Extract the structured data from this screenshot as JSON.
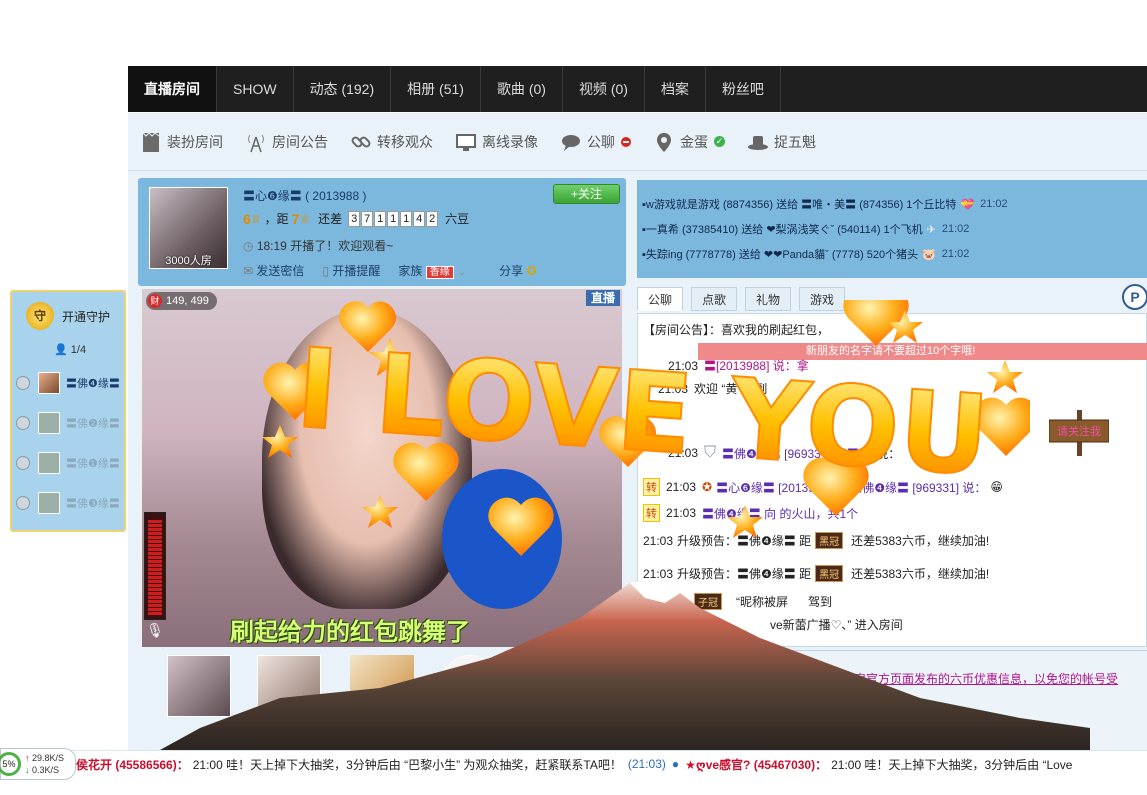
{
  "nav": {
    "tabs": [
      {
        "label": "直播房间"
      },
      {
        "label": "SHOW"
      },
      {
        "label": "动态 (192)"
      },
      {
        "label": "相册 (51)"
      },
      {
        "label": "歌曲 (0)"
      },
      {
        "label": "视频 (0)"
      },
      {
        "label": "档案"
      },
      {
        "label": "粉丝吧"
      }
    ]
  },
  "toolbar": {
    "items": [
      {
        "label": "装扮房间",
        "icon": "doc-icon"
      },
      {
        "label": "房间公告",
        "icon": "broadcast-tower-icon"
      },
      {
        "label": "转移观众",
        "icon": "link-icon"
      },
      {
        "label": "离线录像",
        "icon": "monitor-icon"
      },
      {
        "label": "公聊",
        "icon": "chat-bubble-icon"
      },
      {
        "label": "金蛋",
        "icon": "map-pin-icon"
      },
      {
        "label": "捉五魁",
        "icon": "hat-icon"
      }
    ]
  },
  "anchor": {
    "name": "〓心❻缘〓 ( 2013988 )",
    "viewers": "3000人房",
    "follow_label": "+关注",
    "level_from": "6",
    "level_to": "7",
    "dist_label": "，距",
    "diff_label": "还差",
    "diff_digits": [
      "3",
      "7",
      "1",
      "1",
      "1",
      "4",
      "2"
    ],
    "diff_unit": "六豆",
    "start_text": "18:19 开播了！欢迎观看~",
    "actions": {
      "message": "发送密信",
      "remind": "开播提醒",
      "family": "家族",
      "family_badge": "香缘",
      "share": "分享"
    }
  },
  "video": {
    "cash": "149, 499",
    "cash_icon": "财",
    "live_label": "直播",
    "subtitle": "刷起给力的红包跳舞了"
  },
  "guard": {
    "title": "开通守护",
    "shield_text": "守",
    "count": "1/4",
    "rows": [
      {
        "name": "〓佛❹缘〓",
        "active": true
      },
      {
        "name": "〓佛❷缘〓",
        "active": false
      },
      {
        "name": "〓佛❶缘〓",
        "active": false
      },
      {
        "name": "〓佛❸缘〓",
        "active": false
      }
    ]
  },
  "gifts": [
    {
      "text": "▪w游戏就是游戏 (8874356) 送给 〓唯・美〓 (874356) 1个丘比特",
      "time": "21:02"
    },
    {
      "text": "▪一真希 (37385410) 送给 ❤梨涡浅笑ぐˇ (540114) 1个飞机",
      "time": "21:02"
    },
    {
      "text": "▪失踪ing (7778778) 送给 ❤❤Panda貓ˇ (7778) 520个猪头",
      "time": "21:02"
    }
  ],
  "chat": {
    "tabs": [
      {
        "label": "公聊"
      },
      {
        "label": "点歌"
      },
      {
        "label": "礼物"
      },
      {
        "label": "游戏"
      }
    ],
    "p_badge": "P",
    "notice_bar": "新朋友的名字请不要超过10个字哦!",
    "announcement": "【房间公告】：喜欢我的刷起红包，",
    "lines": [
      {
        "time": "21:03",
        "text": "〓[2013988] 说：拿"
      },
      {
        "time": "21:03",
        "text": "欢迎 “黄",
        "extra": "驾到"
      },
      {
        "time": "21:03",
        "text": "〓佛❹缘〓 [96933 ❻缘〓 [2",
        "extra": "说："
      },
      {
        "time": "21:03",
        "text": "〓心❻缘〓 [2013988] 对 〓佛❹缘〓 [969331] 说：",
        "zhuan": "转"
      },
      {
        "time": "21:03",
        "text": "〓佛❹缘〓 向 的火山，共1个",
        "zhuan": "转"
      },
      {
        "time": "21:03",
        "text": "升级预告：〓佛❹缘〓 距",
        "rank": "黑冠",
        "extra": "还差5383六币，继续加油!"
      },
      {
        "time": "21:03",
        "text": "升级预告：〓佛❹缘〓 距",
        "rank": "黑冠",
        "extra": "还差5383六币，继续加油!"
      },
      {
        "time": "",
        "text": "“昵称被屏",
        "rank": "子冠",
        "extra": "驾到"
      },
      {
        "time": "",
        "text": "ve新蕾广播♡、” 进入房间"
      }
    ],
    "sign_text": "请关注我",
    "system_lines": [
      "，请认准六间房官方页面发布的六币优惠信息，以免您的帐号受"
    ]
  },
  "ticker": {
    "items": [
      {
        "name": "侯花开 (45586566)：",
        "text": "21:00 哇！天上掉下大抽奖，3分钟后由 “巴黎小生” 为观众抽奖，赶紧联系TA吧！",
        "time": "(21:03)"
      },
      {
        "name": "★ღve感官? (45467030)：",
        "text": "21:00 哇！天上掉下大抽奖，3分钟后由 “Love",
        "time": ""
      }
    ]
  },
  "speed": {
    "percent": "5%",
    "up": "29.8K/S",
    "down": "0.3K/S"
  },
  "overlay": {
    "love_text": "I LOVE YOU"
  },
  "colors": {
    "nav_bg": "#1f1f1f",
    "panel_blue": "#7cb8de",
    "toolbar_bg": "#e8f2f8",
    "accent_pink": "#b0148a",
    "love_orange": "#ff9d00"
  }
}
